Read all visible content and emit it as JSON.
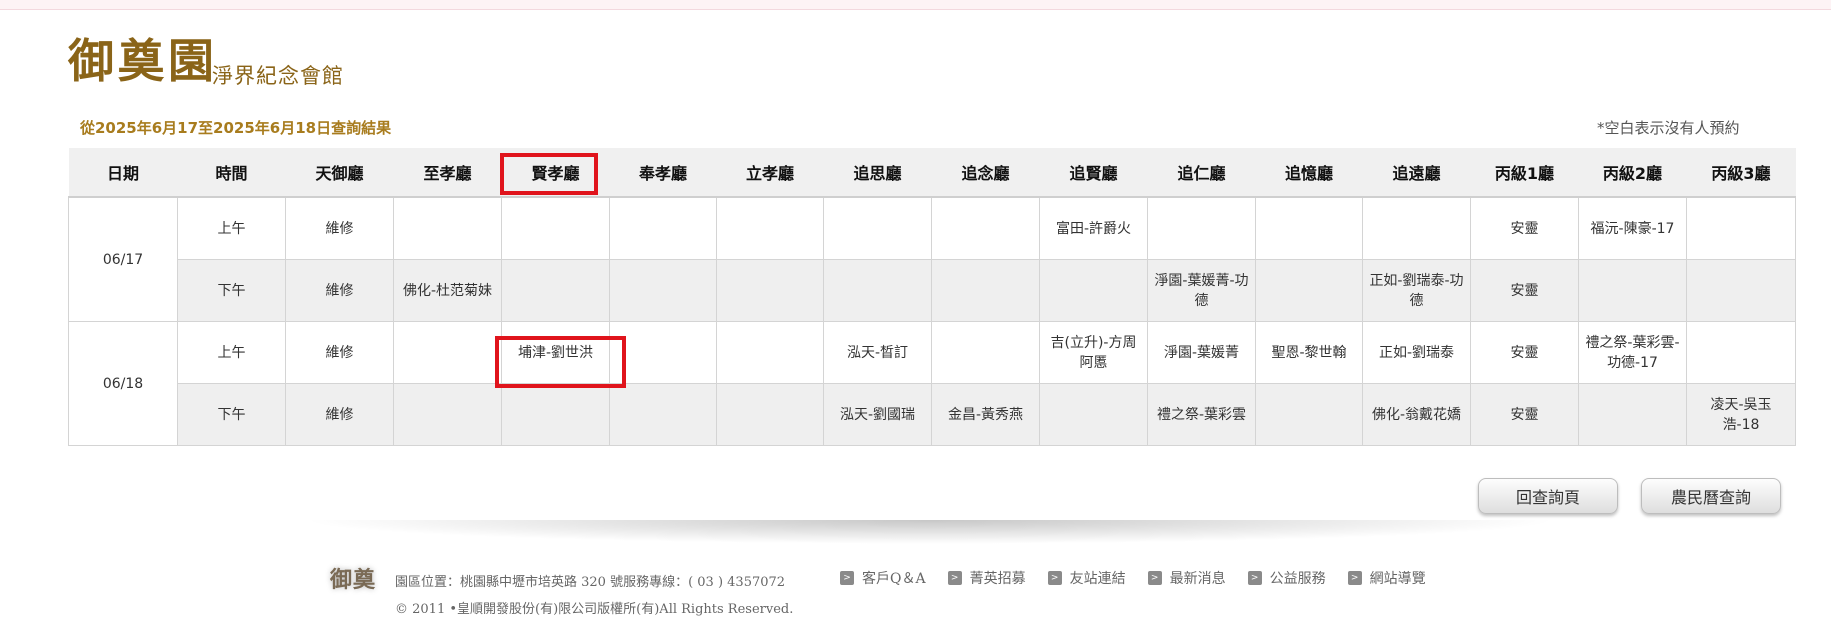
{
  "brand": {
    "logo_main": "御奠園",
    "logo_sub": "淨界紀念會館",
    "footer_logo": "御奠"
  },
  "query_result": "從2025年6月17至2025年6月18日查詢結果",
  "blank_note": "*空白表示沒有人預約",
  "table": {
    "headers": [
      "日期",
      "時間",
      "天御廳",
      "至孝廳",
      "賢孝廳",
      "奉孝廳",
      "立孝廳",
      "追思廳",
      "追念廳",
      "追賢廳",
      "追仁廳",
      "追憶廳",
      "追遠廳",
      "丙級1廳",
      "丙級2廳",
      "丙級3廳"
    ],
    "days": [
      {
        "date": "06/17",
        "rows": [
          {
            "time": "上午",
            "cells": [
              "維修",
              "",
              "",
              "",
              "",
              "",
              "",
              "富田-許爵火",
              "",
              "",
              "",
              "安靈",
              "福沅-陳豪-17",
              ""
            ]
          },
          {
            "time": "下午",
            "cells": [
              "維修",
              "佛化-杜范菊妹",
              "",
              "",
              "",
              "",
              "",
              "",
              "淨園-葉媛菁-功德",
              "",
              "正如-劉瑞泰-功德",
              "安靈",
              "",
              ""
            ]
          }
        ]
      },
      {
        "date": "06/18",
        "rows": [
          {
            "time": "上午",
            "cells": [
              "維修",
              "",
              "埔津-劉世洪",
              "",
              "",
              "泓天-晳訂",
              "",
              "吉(立升)-方周阿慝",
              "淨園-葉媛菁",
              "聖恩-黎世翰",
              "正如-劉瑞泰",
              "安靈",
              "禮之祭-葉彩雲-功德-17",
              ""
            ]
          },
          {
            "time": "下午",
            "cells": [
              "維修",
              "",
              "",
              "",
              "",
              "泓天-劉國瑞",
              "金昌-黃秀燕",
              "",
              "禮之祭-葉彩雲",
              "",
              "佛化-翁戴花嬌",
              "安靈",
              "",
              "凌天-吳玉浩-18"
            ]
          }
        ]
      }
    ]
  },
  "buttons": {
    "back": "回查詢頁",
    "lunar": "農民曆查詢"
  },
  "footer": {
    "address": "園區位置：桃園縣中壢市培英路 320 號服務專線：( 03 ) 4357072",
    "copyright": "© 2011 •皇順開發股份(有)限公司版權所(有)All Rights Reserved.",
    "links": [
      "客戶Q＆A",
      "菁英招募",
      "友站連結",
      "最新消息",
      "公益服務",
      "網站導覽"
    ]
  }
}
